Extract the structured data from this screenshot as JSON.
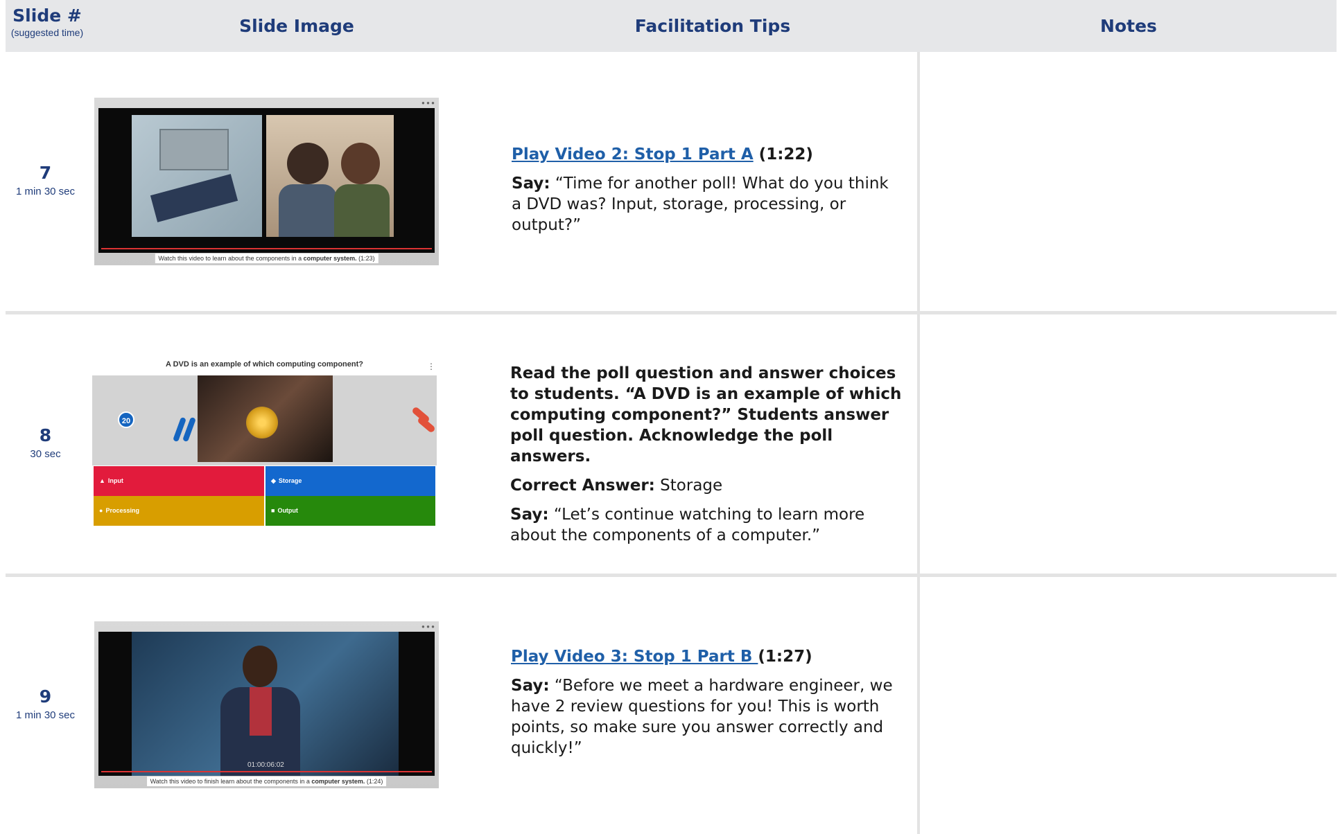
{
  "header": {
    "slide_col": "Slide #",
    "slide_col_sub": "(suggested time)",
    "image_col": "Slide Image",
    "tips_col": "Facilitation Tips",
    "notes_col": "Notes"
  },
  "rows": [
    {
      "number": "7",
      "time": "1 min 30 sec",
      "thumb": {
        "caption_pre": "Watch this video to learn about the components in a ",
        "caption_bold": "computer system.",
        "caption_post": " (1:23)"
      },
      "tips": {
        "link": "Play Video 2: Stop 1 Part A",
        "link_suffix": " (1:22)",
        "say_label": "Say:",
        "say_text": " “Time for another poll! What do you think a DVD was? Input, storage, processing, or output?”"
      }
    },
    {
      "number": "8",
      "time": "30 sec",
      "thumb": {
        "question": "A DVD is an example of which computing component?",
        "count": "20",
        "options": [
          "Input",
          "Storage",
          "Processing",
          "Output"
        ],
        "option_colors": [
          "#e21b3c",
          "#1368ce",
          "#d89e00",
          "#26890c"
        ]
      },
      "tips": {
        "instruction": "Read the poll question and answer choices to students. “A DVD is an example of which computing component?” Students answer poll question. Acknowledge the poll answers.",
        "correct_label": "Correct Answer:",
        "correct_value": " Storage",
        "say_label": "Say:",
        "say_text": " “Let’s continue watching to learn more about the components of a computer.”"
      }
    },
    {
      "number": "9",
      "time": "1 min 30 sec",
      "thumb": {
        "timer": "01:00:06:02",
        "caption_pre": "Watch this video to finish learn about the components in a ",
        "caption_bold": "computer system.",
        "caption_post": " (1:24)"
      },
      "tips": {
        "link": "Play Video 3: Stop 1 Part B ",
        "link_suffix": "(1:27)",
        "say_label": "Say:",
        "say_text": " “Before we meet a hardware engineer, we have 2 review questions for you! This is worth points, so make sure you answer correctly and quickly!”"
      }
    }
  ],
  "colors": {
    "header_bg": "#e6e7e9",
    "heading_blue": "#1f3c7a",
    "link_blue": "#1f5fa8"
  }
}
